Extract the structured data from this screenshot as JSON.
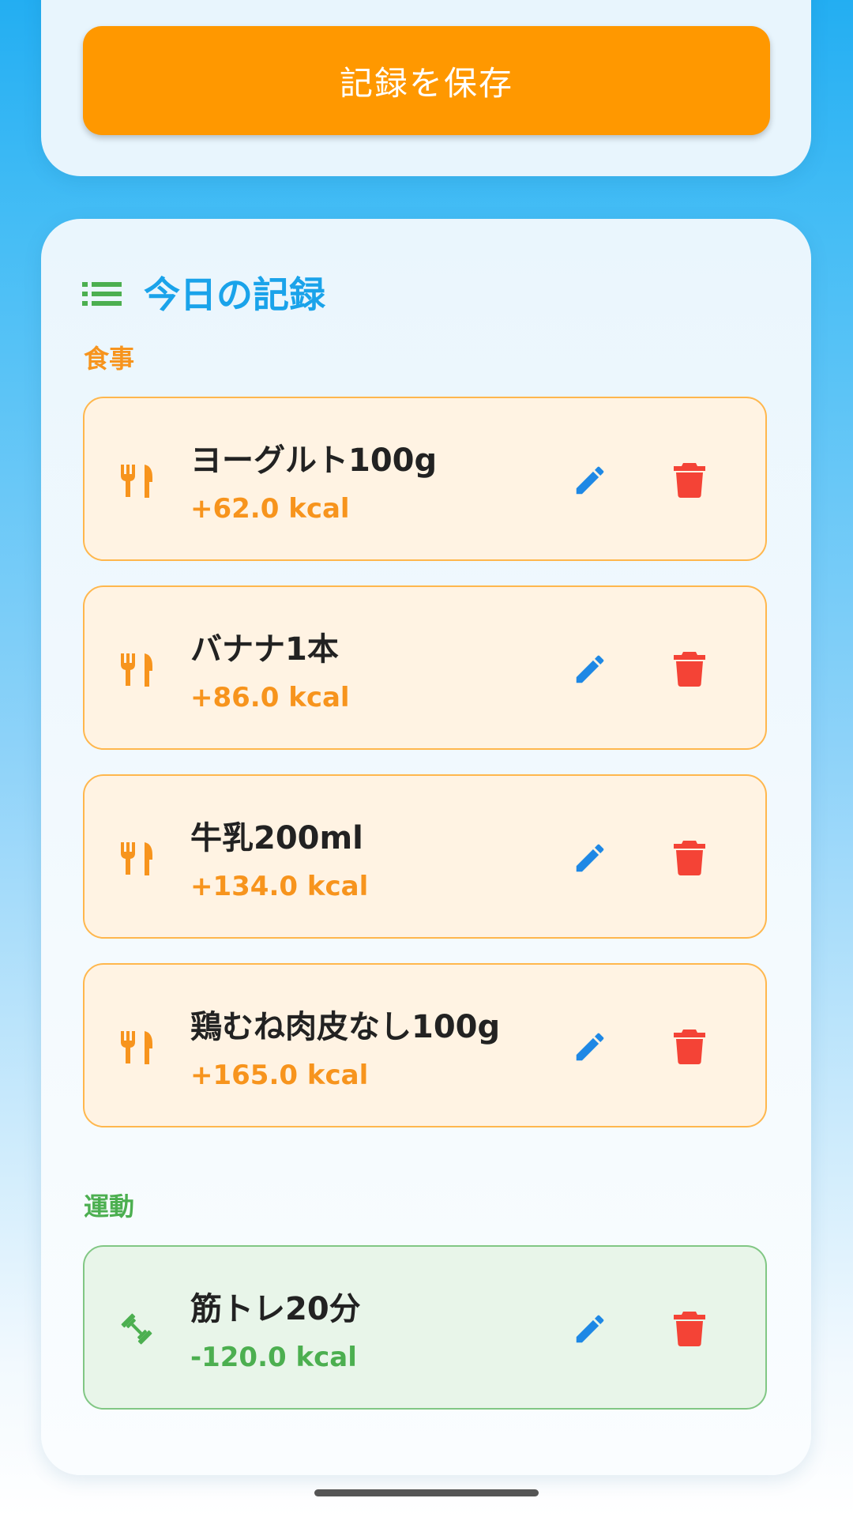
{
  "save_button": {
    "label": "記録を保存"
  },
  "today_section": {
    "title": "今日の記録",
    "icon": "list-icon"
  },
  "food_group": {
    "label": "食事",
    "color": "#f7941d",
    "items": [
      {
        "name": "ヨーグルト100g",
        "kcal": "+62.0 kcal"
      },
      {
        "name": "バナナ1本",
        "kcal": "+86.0 kcal"
      },
      {
        "name": "牛乳200ml",
        "kcal": "+134.0 kcal"
      },
      {
        "name": "鶏むね肉皮なし100g",
        "kcal": "+165.0 kcal"
      }
    ]
  },
  "exercise_group": {
    "label": "運動",
    "color": "#4caf50",
    "items": [
      {
        "name": "筋トレ20分",
        "kcal": "-120.0 kcal"
      }
    ]
  },
  "icons": {
    "food": "restaurant-icon",
    "exercise": "dumbbell-icon",
    "edit": "pencil-icon",
    "delete": "trash-icon"
  },
  "colors": {
    "accent_orange": "#ff9800",
    "title_blue": "#1aa3ea",
    "edit_blue": "#1e88e5",
    "delete_red": "#f44336"
  }
}
